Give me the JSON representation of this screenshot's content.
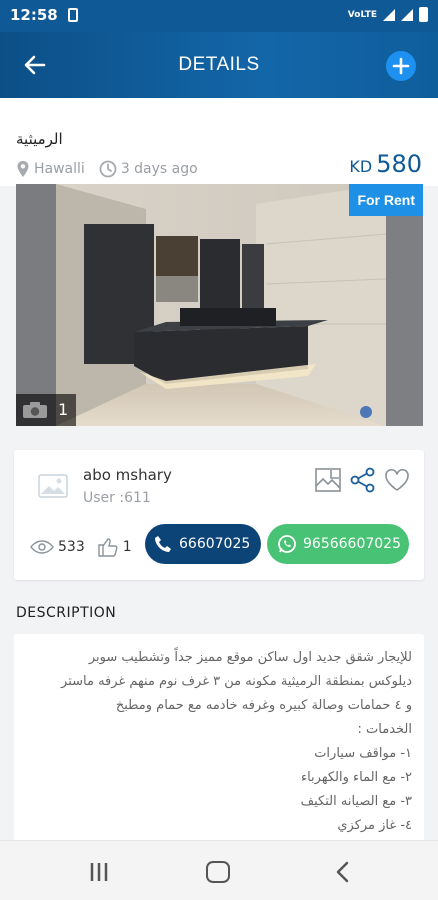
{
  "status": {
    "time": "12:58",
    "right_text": "VoLTE"
  },
  "appbar": {
    "title": "DETAILS"
  },
  "listing": {
    "title": "الرميثية",
    "location": "Hawalli",
    "posted": "3 days ago",
    "currency": "KD",
    "price": "580",
    "badge": "For Rent",
    "photo_count": "1"
  },
  "owner": {
    "name": "abo mshary",
    "user_id": "User :611",
    "views": "533",
    "likes": "1",
    "call_label": "66607025",
    "whatsapp_label": "96566607025"
  },
  "description": {
    "label": "DESCRIPTION",
    "lines": [
      "للإيجار شقق جديد اول ساكن موقع مميز جداً وتشطيب سوبر",
      "ديلوكس بمنطقة الرميثية مكونه من ٣ غرف نوم منهم  غرفه ماستر",
      "و ٤ حمامات وصالة كبيره وغرفه خادمه مع حمام ومطبخ",
      "الخدمات :",
      "١- مواقف سيارات",
      "٢- مع الماء والكهرباء",
      "٣- مع الصيانه التكيف",
      "٤- غاز مركزي"
    ]
  },
  "colors": {
    "primary": "#0f5a96",
    "accent_blue": "#1e90e6",
    "call_button": "#0d4478",
    "whatsapp_button": "#48c274"
  },
  "icons": [
    "back-arrow-icon",
    "add-icon",
    "location-pin-icon",
    "clock-icon",
    "camera-icon",
    "avatar-placeholder-icon",
    "gallery-icon",
    "share-icon",
    "heart-icon",
    "eye-icon",
    "thumbs-up-icon",
    "phone-icon",
    "whatsapp-icon"
  ]
}
